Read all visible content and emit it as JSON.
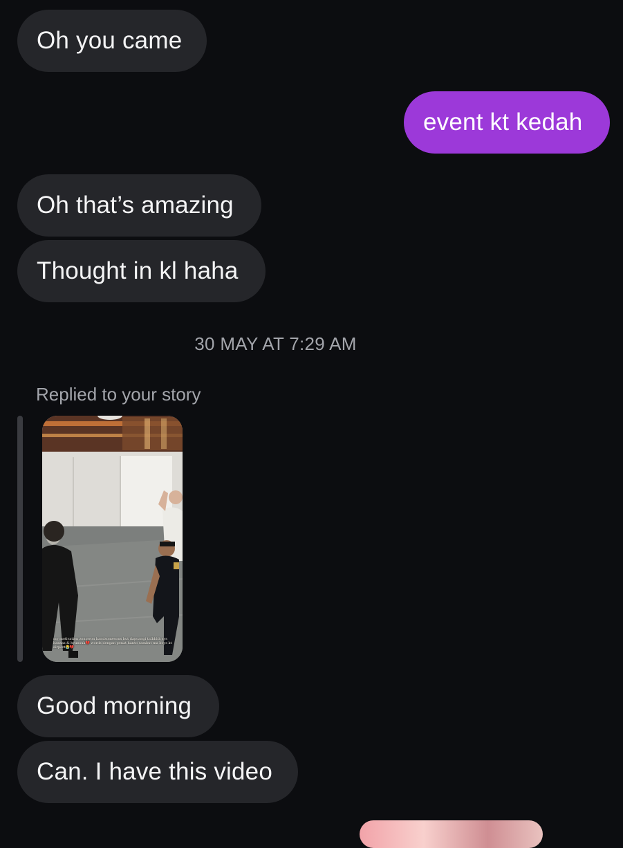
{
  "messages": {
    "m1": "Oh you came",
    "m2": "event kt kedah",
    "m3": "Oh that’s amazing",
    "m4": "Thought in kl haha",
    "m5": "Good morning",
    "m6": "Can. I have this video"
  },
  "timestamp": "30 MAY AT 7:29 AM",
  "story_reply": {
    "label": "Replied to your story",
    "caption": "my motivation zongwon handsomesons but dapoangi tidhhhh sys hansas & hyunsuk💔 words dengan penat hanto sambut ma boys kt airport😭💔"
  },
  "colors": {
    "background": "#0c0d10",
    "incoming_bubble": "#25262a",
    "outgoing_bubble": "#9c39d9",
    "meta_text": "#a3a5ab"
  }
}
